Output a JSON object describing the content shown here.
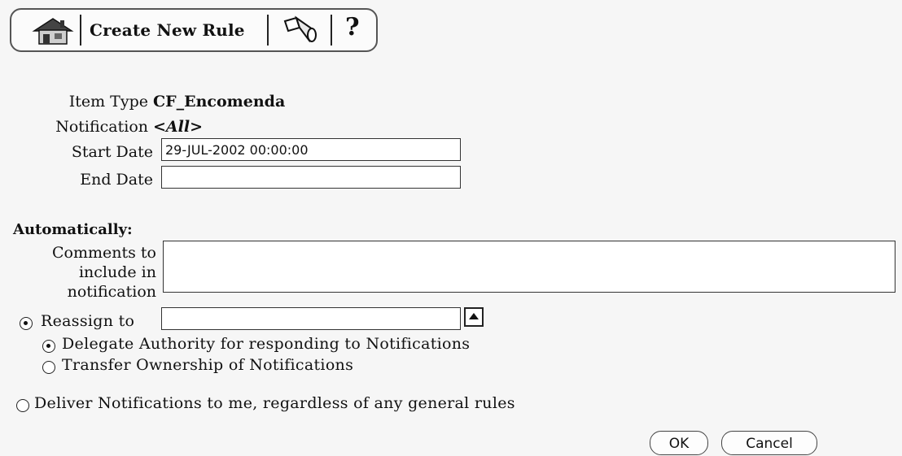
{
  "toolbar": {
    "home_icon": "home-icon",
    "create_rule_label": "Create New Rule",
    "flashlight_icon": "flashlight-icon",
    "help_label": "?"
  },
  "form": {
    "item_type": {
      "label": "Item Type",
      "value": "CF_Encomenda"
    },
    "notification": {
      "label": "Notification",
      "value": "<All>"
    },
    "start_date": {
      "label": "Start Date",
      "value": "29-JUL-2002 00:00:00"
    },
    "end_date": {
      "label": "End Date",
      "value": ""
    }
  },
  "automatically": {
    "title": "Automatically:",
    "comments_label": [
      "Comments to",
      "include in",
      "notification"
    ],
    "comments_value": ""
  },
  "options": {
    "reassign": {
      "label": "Reassign to",
      "value": "",
      "lov_icon": "up-arrow-icon"
    },
    "delegate": {
      "label": "Delegate Authority for responding to Notifications"
    },
    "transfer": {
      "label": "Transfer Ownership of Notifications"
    },
    "deliver": {
      "label": "Deliver Notifications to me, regardless of any general rules"
    }
  },
  "buttons": {
    "ok": "OK",
    "cancel": "Cancel"
  }
}
